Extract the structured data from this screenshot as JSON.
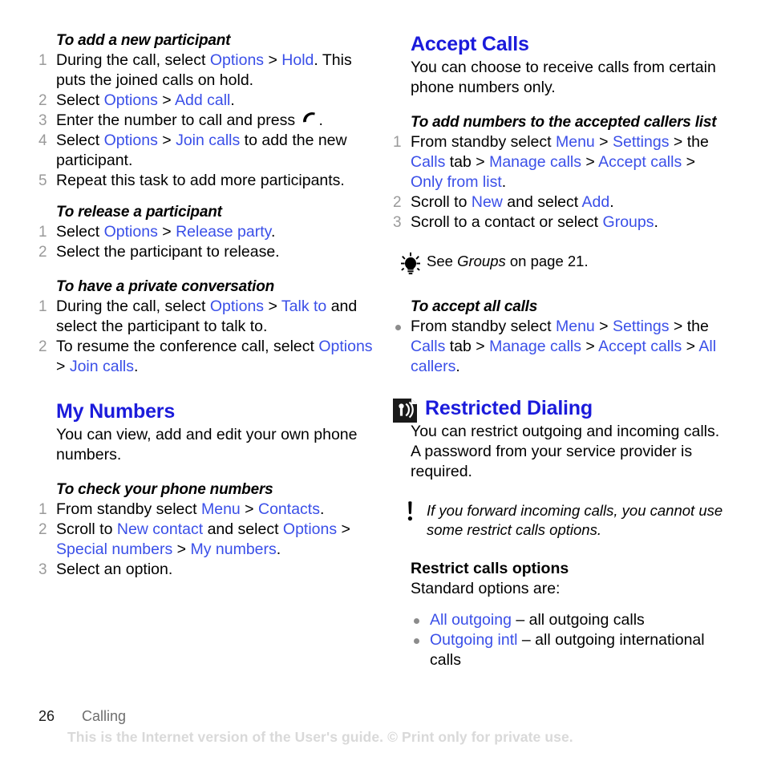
{
  "document": {
    "page_number": "26",
    "chapter": "Calling",
    "watermark": "This is the Internet version of the User's guide. © Print only for private use."
  },
  "colors": {
    "heading_blue": "#1b1bdb",
    "link_blue": "#3a4fe8",
    "marker_gray": "#9a9a9a",
    "watermark_gray": "#d9d9d9"
  },
  "left_column": {
    "task1": {
      "title": "To add a new participant",
      "steps": [
        {
          "n": "1",
          "parts": [
            {
              "t": "During the call, select ",
              "s": "plain"
            },
            {
              "t": "Options",
              "s": "link"
            },
            {
              "t": " > ",
              "s": "plain"
            },
            {
              "t": "Hold",
              "s": "link"
            },
            {
              "t": ". This puts the joined calls on hold.",
              "s": "plain"
            }
          ]
        },
        {
          "n": "2",
          "parts": [
            {
              "t": "Select ",
              "s": "plain"
            },
            {
              "t": "Options",
              "s": "link"
            },
            {
              "t": " > ",
              "s": "plain"
            },
            {
              "t": "Add call",
              "s": "link"
            },
            {
              "t": ".",
              "s": "plain"
            }
          ]
        },
        {
          "n": "3",
          "parts": [
            {
              "t": "Enter the number to call and press ",
              "s": "plain"
            },
            {
              "t": "call-handset-icon",
              "s": "icon"
            },
            {
              "t": ".",
              "s": "plain"
            }
          ]
        },
        {
          "n": "4",
          "parts": [
            {
              "t": "Select ",
              "s": "plain"
            },
            {
              "t": "Options",
              "s": "link"
            },
            {
              "t": " > ",
              "s": "plain"
            },
            {
              "t": "Join calls",
              "s": "link"
            },
            {
              "t": " to add the new participant.",
              "s": "plain"
            }
          ]
        },
        {
          "n": "5",
          "parts": [
            {
              "t": "Repeat this task to add more participants.",
              "s": "plain"
            }
          ]
        }
      ]
    },
    "task2": {
      "title": "To release a participant",
      "steps": [
        {
          "n": "1",
          "parts": [
            {
              "t": "Select ",
              "s": "plain"
            },
            {
              "t": "Options",
              "s": "link"
            },
            {
              "t": " > ",
              "s": "plain"
            },
            {
              "t": "Release party",
              "s": "link"
            },
            {
              "t": ".",
              "s": "plain"
            }
          ]
        },
        {
          "n": "2",
          "parts": [
            {
              "t": "Select the participant to release.",
              "s": "plain"
            }
          ]
        }
      ]
    },
    "task3": {
      "title": "To have a private conversation",
      "steps": [
        {
          "n": "1",
          "parts": [
            {
              "t": "During the call, select ",
              "s": "plain"
            },
            {
              "t": "Options",
              "s": "link"
            },
            {
              "t": " > ",
              "s": "plain"
            },
            {
              "t": "Talk to",
              "s": "link"
            },
            {
              "t": " and select the participant to talk to.",
              "s": "plain"
            }
          ]
        },
        {
          "n": "2",
          "parts": [
            {
              "t": "To resume the conference call, select ",
              "s": "plain"
            },
            {
              "t": "Options",
              "s": "link"
            },
            {
              "t": " > ",
              "s": "plain"
            },
            {
              "t": "Join calls",
              "s": "link"
            },
            {
              "t": ".",
              "s": "plain"
            }
          ]
        }
      ]
    },
    "section_my_numbers": {
      "heading": "My Numbers",
      "intro": "You can view, add and edit your own phone numbers.",
      "task": {
        "title": "To check your phone numbers",
        "steps": [
          {
            "n": "1",
            "parts": [
              {
                "t": "From standby select ",
                "s": "plain"
              },
              {
                "t": "Menu",
                "s": "link"
              },
              {
                "t": " > ",
                "s": "plain"
              },
              {
                "t": "Contacts",
                "s": "link"
              },
              {
                "t": ".",
                "s": "plain"
              }
            ]
          },
          {
            "n": "2",
            "parts": [
              {
                "t": "Scroll to ",
                "s": "plain"
              },
              {
                "t": "New contact",
                "s": "link"
              },
              {
                "t": " and select ",
                "s": "plain"
              },
              {
                "t": "Options",
                "s": "link"
              },
              {
                "t": " > ",
                "s": "plain"
              },
              {
                "t": "Special numbers",
                "s": "link"
              },
              {
                "t": " > ",
                "s": "plain"
              },
              {
                "t": "My numbers",
                "s": "link"
              },
              {
                "t": ".",
                "s": "plain"
              }
            ]
          },
          {
            "n": "3",
            "parts": [
              {
                "t": "Select an option.",
                "s": "plain"
              }
            ]
          }
        ]
      }
    }
  },
  "right_column": {
    "section_accept_calls": {
      "heading": "Accept Calls",
      "intro": "You can choose to receive calls from certain phone numbers only.",
      "task_add": {
        "title": "To add numbers to the accepted callers list",
        "steps": [
          {
            "n": "1",
            "parts": [
              {
                "t": "From standby select ",
                "s": "plain"
              },
              {
                "t": "Menu",
                "s": "link"
              },
              {
                "t": " > ",
                "s": "plain"
              },
              {
                "t": "Settings",
                "s": "link"
              },
              {
                "t": " > the ",
                "s": "plain"
              },
              {
                "t": "Calls",
                "s": "link"
              },
              {
                "t": " tab > ",
                "s": "plain"
              },
              {
                "t": "Manage calls",
                "s": "link"
              },
              {
                "t": " > ",
                "s": "plain"
              },
              {
                "t": "Accept calls",
                "s": "link"
              },
              {
                "t": " > ",
                "s": "plain"
              },
              {
                "t": "Only from list",
                "s": "link"
              },
              {
                "t": ".",
                "s": "plain"
              }
            ]
          },
          {
            "n": "2",
            "parts": [
              {
                "t": "Scroll to ",
                "s": "plain"
              },
              {
                "t": "New",
                "s": "link"
              },
              {
                "t": " and select ",
                "s": "plain"
              },
              {
                "t": "Add",
                "s": "link"
              },
              {
                "t": ".",
                "s": "plain"
              }
            ]
          },
          {
            "n": "3",
            "parts": [
              {
                "t": "Scroll to a contact or select ",
                "s": "plain"
              },
              {
                "t": "Groups",
                "s": "link"
              },
              {
                "t": ".",
                "s": "plain"
              }
            ]
          }
        ]
      },
      "tip": {
        "icon": "lightbulb-tip-icon",
        "parts": [
          {
            "t": "See ",
            "s": "plain"
          },
          {
            "t": "Groups",
            "s": "italic"
          },
          {
            "t": " on page 21.",
            "s": "plain"
          }
        ]
      },
      "task_all": {
        "title": "To accept all calls",
        "steps": [
          {
            "n": "•",
            "parts": [
              {
                "t": "From standby select ",
                "s": "plain"
              },
              {
                "t": "Menu",
                "s": "link"
              },
              {
                "t": " > ",
                "s": "plain"
              },
              {
                "t": "Settings",
                "s": "link"
              },
              {
                "t": " > the ",
                "s": "plain"
              },
              {
                "t": "Calls",
                "s": "link"
              },
              {
                "t": " tab > ",
                "s": "plain"
              },
              {
                "t": "Manage calls",
                "s": "link"
              },
              {
                "t": " > ",
                "s": "plain"
              },
              {
                "t": "Accept calls",
                "s": "link"
              },
              {
                "t": " > ",
                "s": "plain"
              },
              {
                "t": "All callers",
                "s": "link"
              },
              {
                "t": ".",
                "s": "plain"
              }
            ]
          }
        ]
      }
    },
    "section_restricted_dialing": {
      "icon": "restricted-dialing-icon",
      "heading": "Restricted Dialing",
      "intro": "You can restrict outgoing and incoming calls. A password from your service provider is required.",
      "warning": {
        "icon": "exclamation-note-icon",
        "text": "If you forward incoming calls, you cannot use some restrict calls options."
      },
      "options_block": {
        "title": "Restrict calls options",
        "intro": "Standard options are:",
        "items": [
          {
            "parts": [
              {
                "t": "All outgoing",
                "s": "link"
              },
              {
                "t": " – all outgoing calls",
                "s": "plain"
              }
            ]
          },
          {
            "parts": [
              {
                "t": "Outgoing intl",
                "s": "link"
              },
              {
                "t": " – all outgoing international calls",
                "s": "plain"
              }
            ]
          }
        ]
      }
    }
  }
}
